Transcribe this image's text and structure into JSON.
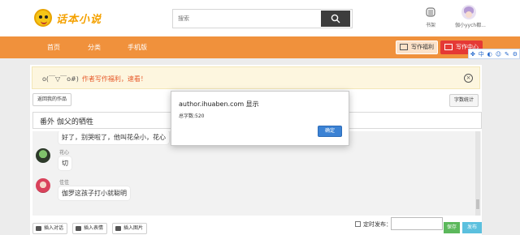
{
  "logo": {
    "text": "话本小说"
  },
  "search": {
    "placeholder": "搜索"
  },
  "header": {
    "shelf_label": "书架",
    "user_name": "伽小yych都..."
  },
  "nav": {
    "home": "首页",
    "category": "分类",
    "mobile": "手机版",
    "write_benefit": "写作福利",
    "write_center": "写作中心"
  },
  "ime": {
    "lang": "中"
  },
  "notice": {
    "prefix": "o(￣▽￣o#)",
    "link": "作者写作福利，速看！"
  },
  "toolbar": {
    "back_label": "返回我的作品",
    "wordcount_label": "字数统计"
  },
  "chapter": {
    "title": "番外    伽父的牺牲"
  },
  "messages": [
    {
      "name": "",
      "text": "好了，别哭啦了，他叫花朵小，花心"
    },
    {
      "name": "花心",
      "text": "切"
    },
    {
      "name": "佳佳",
      "text": "伽罗这孩子打小就聪明"
    }
  ],
  "bottom": {
    "insert_dialog": "插入对话",
    "insert_emoji": "插入表情",
    "insert_image": "插入图片",
    "schedule_label": "定时发布：",
    "save": "保存",
    "publish": "发布"
  },
  "dialog": {
    "title": "author.ihuaben.com 显示",
    "message": "总字数:520",
    "ok": "确定"
  },
  "colors": {
    "nav": "#f0913c",
    "accent_red": "#e53935",
    "dialog_btn": "#3b82d4"
  }
}
